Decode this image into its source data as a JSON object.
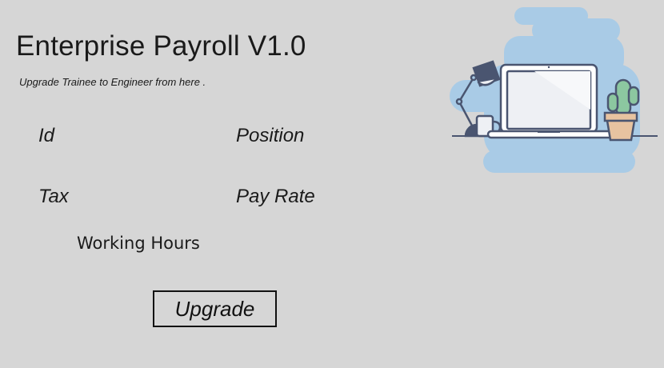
{
  "app": {
    "title": "Enterprise Payroll V1.0",
    "subtitle": "Upgrade Trainee to Engineer from here ."
  },
  "form": {
    "id_label": "Id",
    "position_label": "Position",
    "tax_label": "Tax",
    "pay_rate_label": "Pay Rate",
    "working_hours_label": "Working Hours"
  },
  "actions": {
    "upgrade_label": "Upgrade"
  },
  "illustration": {
    "icon": "workspace-laptop-illustration",
    "colors": {
      "background": "#d6d6d6",
      "blob": "#a9cbe6",
      "outline": "#4a5570",
      "screen": "#eef0f4",
      "cactus": "#8cc7a0",
      "pot": "#e7c3a0"
    }
  }
}
